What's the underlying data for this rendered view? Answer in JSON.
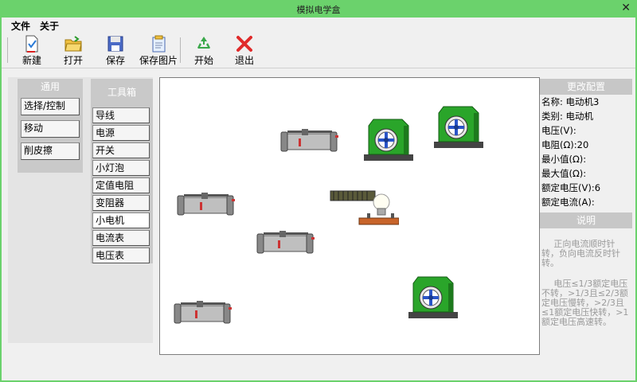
{
  "window": {
    "title": "模拟电学盒",
    "close": "✕"
  },
  "menu": {
    "file": "文件",
    "about": "关于"
  },
  "toolbar": {
    "new": "新建",
    "open": "打开",
    "save": "保存",
    "save_image": "保存图片",
    "start": "开始",
    "exit": "退出"
  },
  "general": {
    "header": "通用",
    "items": [
      "选择/控制",
      "移动",
      "削皮擦"
    ]
  },
  "toolbox": {
    "header": "工具箱",
    "items": [
      "导线",
      "电源",
      "开关",
      "小灯泡",
      "定值电阻",
      "变阻器",
      "小电机",
      "电流表",
      "电压表"
    ],
    "selected": "小电机"
  },
  "properties": {
    "header": "更改配置",
    "rows": [
      {
        "label": "名称:",
        "value": "电动机3"
      },
      {
        "label": "类别:",
        "value": "电动机"
      },
      {
        "label": "电压(V):",
        "value": ""
      },
      {
        "label": "电阻(Ω):",
        "value": "20"
      },
      {
        "label": "最小值(Ω):",
        "value": ""
      },
      {
        "label": "最大值(Ω):",
        "value": ""
      },
      {
        "label": "额定电压(V):",
        "value": "6"
      },
      {
        "label": "额定电流(A):",
        "value": ""
      }
    ]
  },
  "explanation": {
    "header": "说明",
    "p1": "正向电流顺时针转，负向电流反时针转。",
    "p2": "电压≤1/3额定电压不转，>1/3且≤2/3额定电压慢转，>2/3且≤1额定电压快转，>1额定电压高速转。"
  },
  "canvas": {
    "components": [
      {
        "kind": "rheostat",
        "name": "rheostat-1"
      },
      {
        "kind": "rheostat",
        "name": "rheostat-2"
      },
      {
        "kind": "rheostat",
        "name": "rheostat-3"
      },
      {
        "kind": "rheostat",
        "name": "rheostat-4"
      },
      {
        "kind": "motor",
        "name": "motor-1"
      },
      {
        "kind": "motor",
        "name": "motor-2"
      },
      {
        "kind": "motor",
        "name": "motor-3"
      },
      {
        "kind": "bulb",
        "name": "bulb-1"
      }
    ]
  },
  "colors": {
    "titlebar": "#6bd26c",
    "motor_green": "#2aa52a",
    "motor_blue": "#2a55c8",
    "panel_gray": "#c9c9c9"
  },
  "icons": {
    "new": "new-document-icon",
    "open": "open-folder-icon",
    "save": "save-disk-icon",
    "save_image": "save-image-icon",
    "start": "recycle-start-icon",
    "exit": "red-x-exit-icon"
  }
}
